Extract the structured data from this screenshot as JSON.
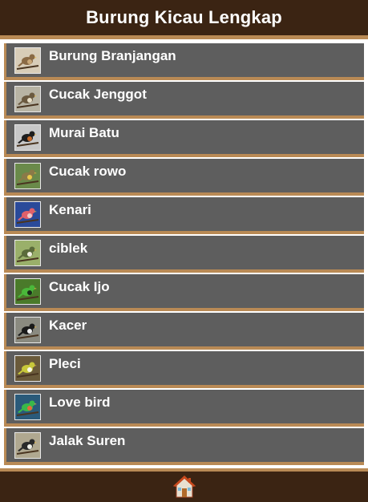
{
  "header": {
    "title": "Burung Kicau Lengkap"
  },
  "birds": [
    {
      "label": "Burung Branjangan",
      "icon": "branjangan-bird-thumbnail",
      "bg": "#d8cdb8",
      "body": "#8a6a45",
      "accent": "#c9a878"
    },
    {
      "label": "Cucak Jenggot",
      "icon": "cucak-jenggot-bird-thumbnail",
      "bg": "#b8b4a4",
      "body": "#6b5a40",
      "accent": "#e8e0c8"
    },
    {
      "label": "Murai Batu",
      "icon": "murai-batu-bird-thumbnail",
      "bg": "#c8c8c8",
      "body": "#1e1e1e",
      "accent": "#c86a28"
    },
    {
      "label": "Cucak rowo",
      "icon": "cucak-rowo-bird-thumbnail",
      "bg": "#6a8a4a",
      "body": "#8a7a48",
      "accent": "#e8c84a"
    },
    {
      "label": "Kenari",
      "icon": "kenari-bird-thumbnail",
      "bg": "#2a4a9a",
      "body": "#e0606a",
      "accent": "#f2c8c8"
    },
    {
      "label": "ciblek",
      "icon": "ciblek-bird-thumbnail",
      "bg": "#9ab06a",
      "body": "#5a6a3a",
      "accent": "#f0f0e0"
    },
    {
      "label": "Cucak Ijo",
      "icon": "cucak-ijo-bird-thumbnail",
      "bg": "#4a7a2a",
      "body": "#4ab83a",
      "accent": "#1a2a1a"
    },
    {
      "label": "Kacer",
      "icon": "kacer-bird-thumbnail",
      "bg": "#8a8a80",
      "body": "#1a1a1a",
      "accent": "#f0f0f0"
    },
    {
      "label": "Pleci",
      "icon": "pleci-bird-thumbnail",
      "bg": "#6a5a3a",
      "body": "#c8c83a",
      "accent": "#f8f8e8"
    },
    {
      "label": "Love bird",
      "icon": "love-bird-thumbnail",
      "bg": "#2a5a7a",
      "body": "#3ab84a",
      "accent": "#e86a3a"
    },
    {
      "label": "Jalak Suren",
      "icon": "jalak-suren-bird-thumbnail",
      "bg": "#b0a890",
      "body": "#2a2a2a",
      "accent": "#f0f0e8"
    }
  ],
  "footer": {
    "home_icon": "home-icon"
  },
  "colors": {
    "header_bg": "#3b2413",
    "stripe": "#b98a55",
    "item_bg": "#5e5e5e"
  }
}
